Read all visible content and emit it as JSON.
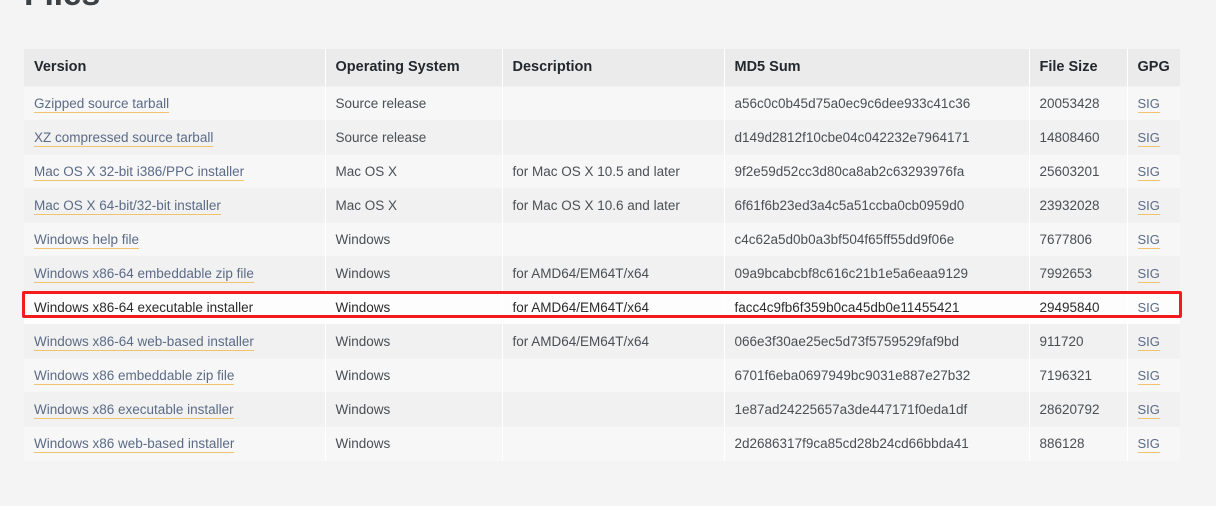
{
  "page": {
    "title": "Files",
    "background_color": "#f4f4f4"
  },
  "highlight": {
    "color": "#f21c1c",
    "target_row_index": 6,
    "target_label": "Windows x86-64 executable installer"
  },
  "table": {
    "name": "release-files-table",
    "columns": [
      {
        "key": "version",
        "label": "Version"
      },
      {
        "key": "os",
        "label": "Operating System"
      },
      {
        "key": "description",
        "label": "Description"
      },
      {
        "key": "md5",
        "label": "MD5 Sum"
      },
      {
        "key": "size",
        "label": "File Size"
      },
      {
        "key": "gpg",
        "label": "GPG"
      }
    ],
    "gpg_link_label": "SIG",
    "rows": [
      {
        "version": "Gzipped source tarball",
        "os": "Source release",
        "description": "",
        "md5": "a56c0c0b45d75a0ec9c6dee933c41c36",
        "size": "20053428",
        "gpg": "SIG"
      },
      {
        "version": "XZ compressed source tarball",
        "os": "Source release",
        "description": "",
        "md5": "d149d2812f10cbe04c042232e7964171",
        "size": "14808460",
        "gpg": "SIG"
      },
      {
        "version": "Mac OS X 32-bit i386/PPC installer",
        "os": "Mac OS X",
        "description": "for Mac OS X 10.5 and later",
        "md5": "9f2e59d52cc3d80ca8ab2c63293976fa",
        "size": "25603201",
        "gpg": "SIG"
      },
      {
        "version": "Mac OS X 64-bit/32-bit installer",
        "os": "Mac OS X",
        "description": "for Mac OS X 10.6 and later",
        "md5": "6f61f6b23ed3a4c5a51ccba0cb0959d0",
        "size": "23932028",
        "gpg": "SIG"
      },
      {
        "version": "Windows help file",
        "os": "Windows",
        "description": "",
        "md5": "c4c62a5d0b0a3bf504f65ff55dd9f06e",
        "size": "7677806",
        "gpg": "SIG"
      },
      {
        "version": "Windows x86-64 embeddable zip file",
        "os": "Windows",
        "description": "for AMD64/EM64T/x64",
        "md5": "09a9bcabcbf8c616c21b1e5a6eaa9129",
        "size": "7992653",
        "gpg": "SIG"
      },
      {
        "version": "Windows x86-64 executable installer",
        "os": "Windows",
        "description": "for AMD64/EM64T/x64",
        "md5": "facc4c9fb6f359b0ca45db0e11455421",
        "size": "29495840",
        "gpg": "SIG"
      },
      {
        "version": "Windows x86-64 web-based installer",
        "os": "Windows",
        "description": "for AMD64/EM64T/x64",
        "md5": "066e3f30ae25ec5d73f5759529faf9bd",
        "size": "911720",
        "gpg": "SIG"
      },
      {
        "version": "Windows x86 embeddable zip file",
        "os": "Windows",
        "description": "",
        "md5": "6701f6eba0697949bc9031e887e27b32",
        "size": "7196321",
        "gpg": "SIG"
      },
      {
        "version": "Windows x86 executable installer",
        "os": "Windows",
        "description": "",
        "md5": "1e87ad24225657a3de447171f0eda1df",
        "size": "28620792",
        "gpg": "SIG"
      },
      {
        "version": "Windows x86 web-based installer",
        "os": "Windows",
        "description": "",
        "md5": "2d2686317f9ca85cd28b24cd66bbda41",
        "size": "886128",
        "gpg": "SIG"
      }
    ]
  }
}
